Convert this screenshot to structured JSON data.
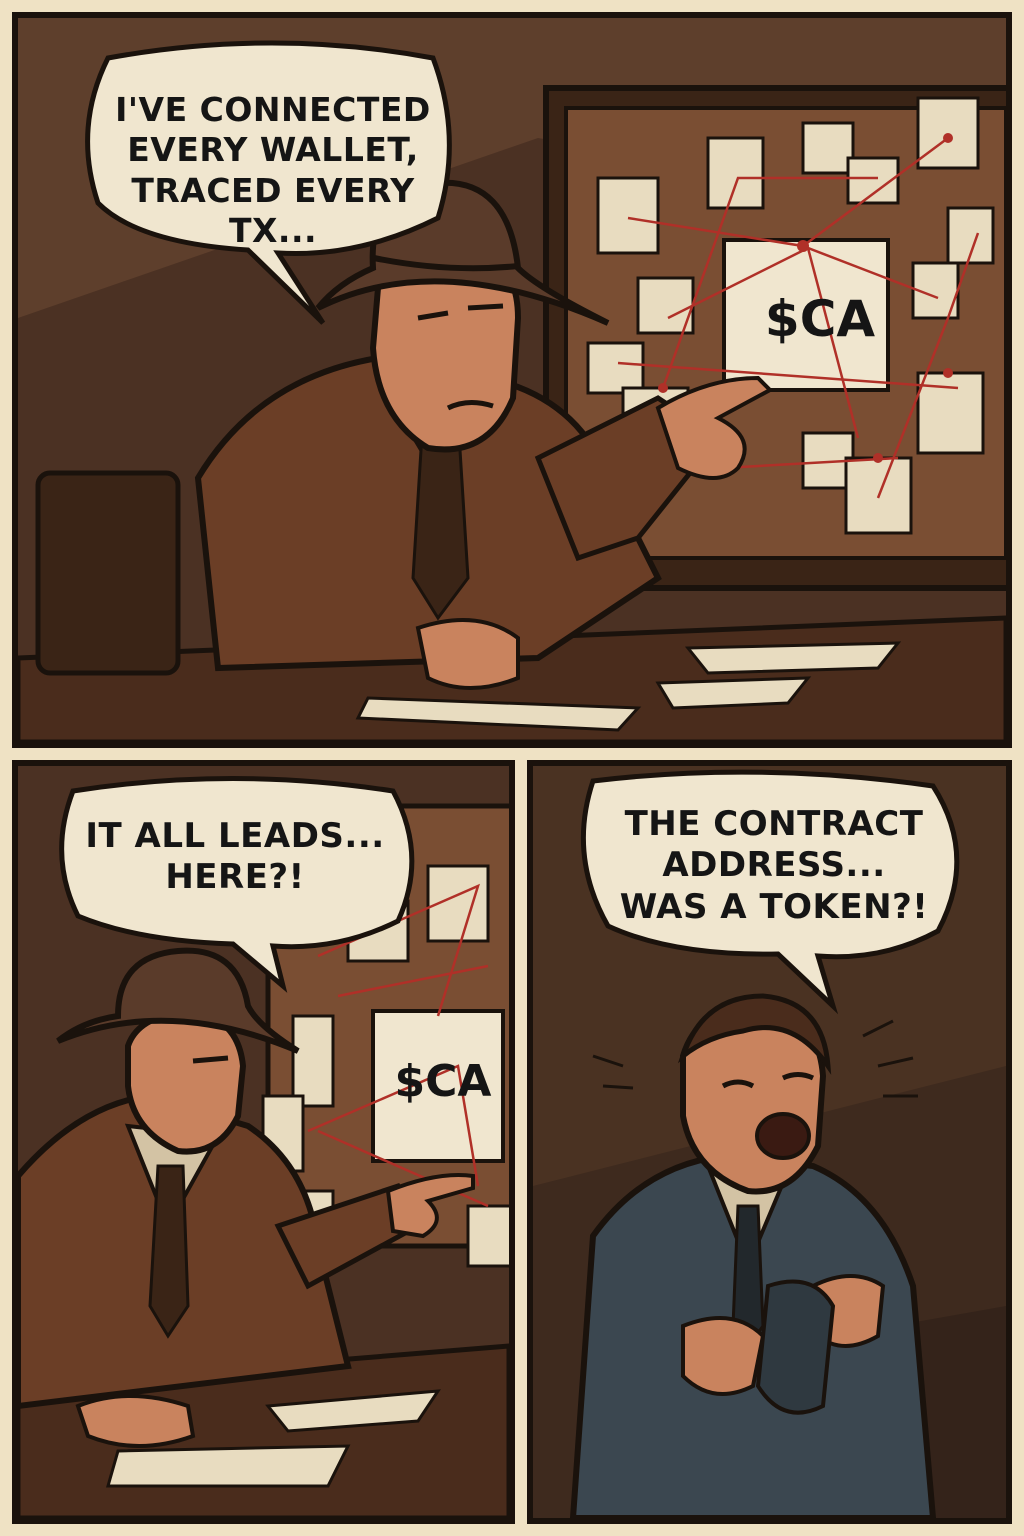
{
  "panels": [
    {
      "speech": [
        "I'VE CONNECTED",
        "EVERY WALLET,",
        "TRACED EVERY",
        "TX..."
      ],
      "board_label": "$CA"
    },
    {
      "speech": [
        "IT ALL LEADS...",
        "HERE?!"
      ],
      "board_label": "$CA"
    },
    {
      "speech": [
        "THE CONTRACT",
        "ADDRESS...",
        "WAS A TOKEN?!"
      ]
    }
  ],
  "colors": {
    "gutter": "#efe2c4",
    "ink": "#1a120c",
    "wall": "#5a3b2a",
    "corkboard": "#7a4e33",
    "coat": "#6b3e26",
    "suit": "#3b4750",
    "skin": "#c9835e",
    "paper": "#e8dcc0",
    "string": "#b03028"
  }
}
